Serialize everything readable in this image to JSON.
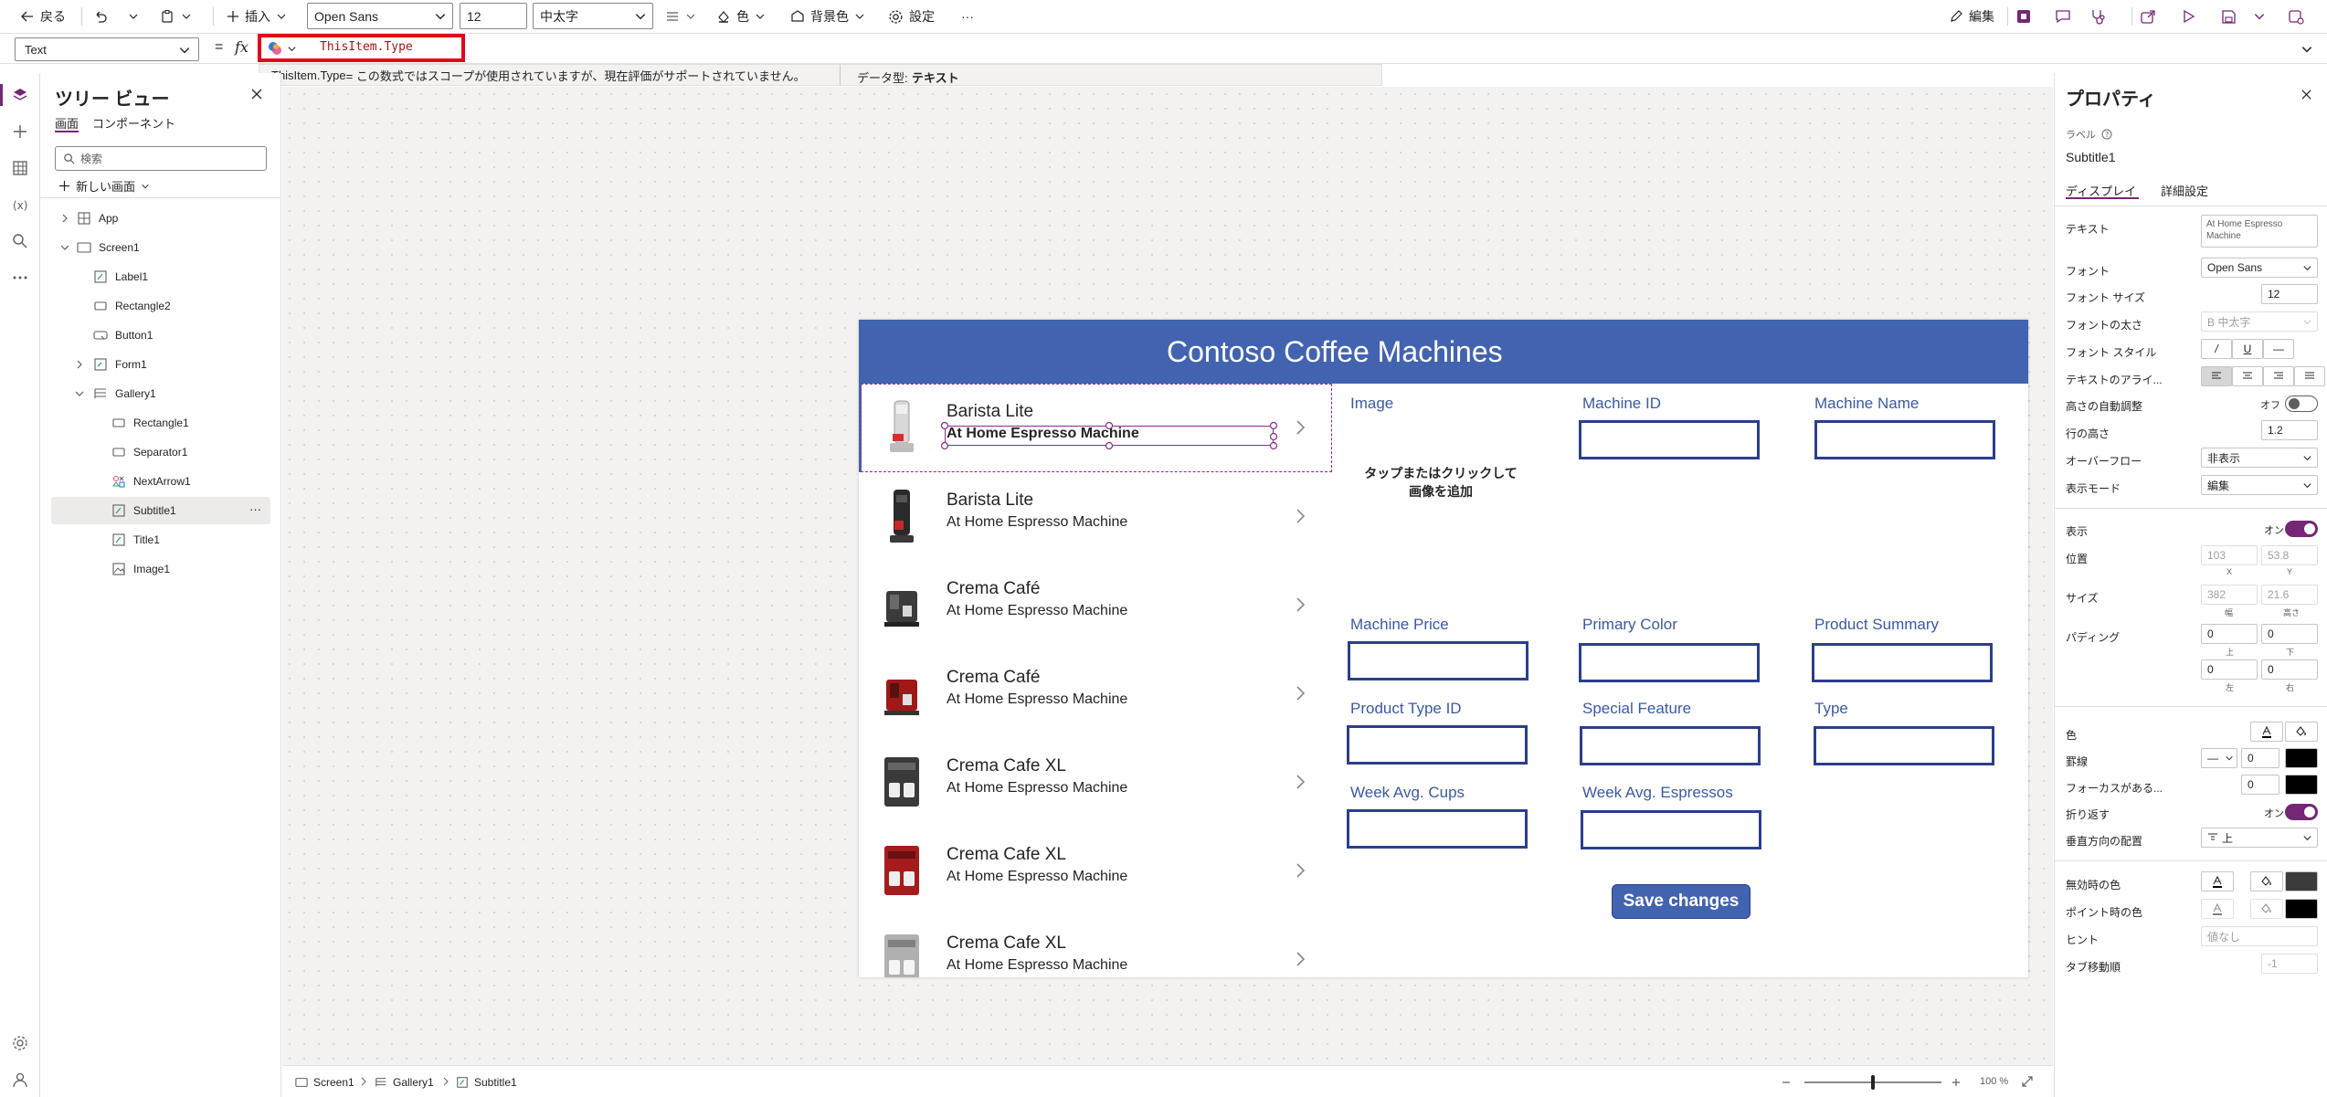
{
  "toolbar": {
    "back": "戻る",
    "insert": "插入",
    "font": "Open Sans",
    "font_size": "12",
    "font_weight": "中太字",
    "fill": "背景色",
    "settings": "設定",
    "more": "···",
    "edit": "編集"
  },
  "formula_bar": {
    "property": "Text",
    "fx": "fx",
    "formula": "ThisItem.Type",
    "hint_formula": "ThisItem.Type",
    "hint_message": " = この数式ではスコープが使用されていますが、現在評価がサポートされていません。",
    "data_type_label": "データ型:",
    "data_type_value": "テキスト"
  },
  "tree": {
    "title": "ツリー ビュー",
    "tab_screens": "画面",
    "tab_components": "コンポーネント",
    "search_placeholder": "検索",
    "new_screen": "新しい画面",
    "items": [
      {
        "label": "App"
      },
      {
        "label": "Screen1"
      },
      {
        "label": "Label1"
      },
      {
        "label": "Rectangle2"
      },
      {
        "label": "Button1"
      },
      {
        "label": "Form1"
      },
      {
        "label": "Gallery1"
      },
      {
        "label": "Rectangle1"
      },
      {
        "label": "Separator1"
      },
      {
        "label": "NextArrow1"
      },
      {
        "label": "Subtitle1"
      },
      {
        "label": "Title1"
      },
      {
        "label": "Image1"
      }
    ],
    "row_more": "···"
  },
  "app": {
    "header": "Contoso Coffee Machines",
    "gallery": [
      {
        "title": "Barista Lite",
        "subtitle": "At Home Espresso Machine"
      },
      {
        "title": "Barista Lite",
        "subtitle": "At Home Espresso Machine"
      },
      {
        "title": "Crema Café",
        "subtitle": "At Home Espresso Machine"
      },
      {
        "title": "Crema Café",
        "subtitle": "At Home Espresso Machine"
      },
      {
        "title": "Crema Cafe XL",
        "subtitle": "At Home Espresso Machine"
      },
      {
        "title": "Crema Cafe XL",
        "subtitle": "At Home Espresso Machine"
      },
      {
        "title": "Crema Cafe XL",
        "subtitle": "At Home Espresso Machine"
      }
    ],
    "form": {
      "image_label": "Image",
      "image_placeholder": "タップまたはクリックして画像を追加",
      "fields": [
        {
          "label": "Machine ID"
        },
        {
          "label": "Machine Name"
        },
        {
          "label": "Machine Price"
        },
        {
          "label": "Primary Color"
        },
        {
          "label": "Product Summary"
        },
        {
          "label": "Product Type ID"
        },
        {
          "label": "Special Feature"
        },
        {
          "label": "Type"
        },
        {
          "label": "Week Avg. Cups"
        },
        {
          "label": "Week Avg. Espressos"
        }
      ],
      "save": "Save changes"
    }
  },
  "status": {
    "crumbs": [
      "Screen1",
      "Gallery1",
      "Subtitle1"
    ],
    "zoom": "100 %",
    "zoom_fraction": 0.5
  },
  "props": {
    "title": "プロパティ",
    "kind": "ラベル",
    "name": "Subtitle1",
    "tab_display": "ディスプレイ",
    "tab_advanced": "詳細設定",
    "text_label": "テキスト",
    "text_value": "At Home Espresso Machine",
    "font_label": "フォント",
    "font_value": "Open Sans",
    "font_size_label": "フォント サイズ",
    "font_size_value": "12",
    "font_weight_label": "フォントの太さ",
    "font_weight_value": "B  中太字",
    "font_style_label": "フォント スタイル",
    "font_style_i": "/",
    "font_style_u": "U",
    "font_style_s": "—",
    "align_label": "テキストのアライ...",
    "autoheight_label": "高さの自動調整",
    "autoheight_value": "オフ",
    "line_height_label": "行の高さ",
    "line_height_value": "1.2",
    "overflow_label": "オーバーフロー",
    "overflow_value": "非表示",
    "display_mode_label": "表示モード",
    "display_mode_value": "編集",
    "visible_label": "表示",
    "visible_value": "オン",
    "position_label": "位置",
    "pos_x": "103",
    "pos_y": "53.8",
    "x": "X",
    "y": "Y",
    "size_label": "サイズ",
    "width": "382",
    "height": "21.6",
    "w": "幅",
    "h": "高さ",
    "padding_label": "パディング",
    "pad_top": "0",
    "pad_bottom": "0",
    "pad_left": "0",
    "pad_right": "0",
    "top": "上",
    "bottom": "下",
    "left": "左",
    "right": "右",
    "color_label": "色",
    "border_label": "罫線",
    "border_value": "0",
    "focus_label": "フォーカスがある...",
    "focus_value": "0",
    "wrap_label": "折り返す",
    "wrap_value": "オン",
    "valign_label": "垂直方向の配置",
    "valign_value": "上",
    "disabled_color_label": "無効時の色",
    "hover_color_label": "ポイント時の色",
    "tooltip_label": "ヒント",
    "tooltip_value": "値なし",
    "tab_index_label": "タブ移動順",
    "tab_index_value": "-1"
  },
  "colors": {
    "accent": "#742774",
    "app_header": "#4264b0",
    "field_border": "#2b3f8a",
    "highlight": "#e3001b"
  }
}
